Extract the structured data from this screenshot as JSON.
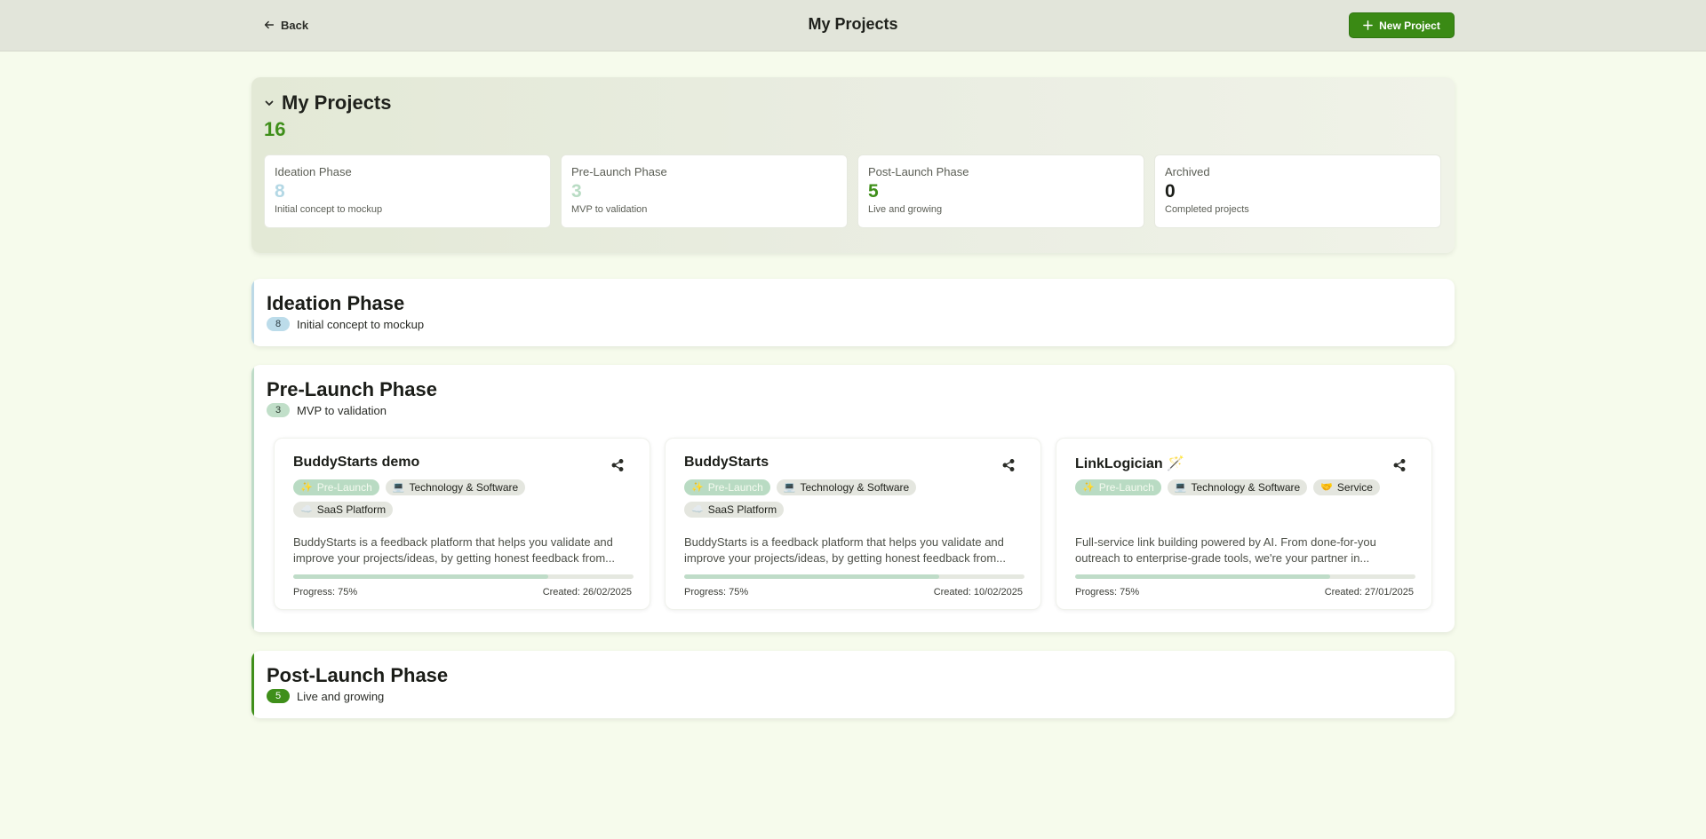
{
  "header": {
    "back_label": "Back",
    "title": "My Projects",
    "new_project_label": "New Project"
  },
  "summary": {
    "title": "My Projects",
    "total": "16",
    "stats": [
      {
        "label": "Ideation Phase",
        "count": "8",
        "desc": "Initial concept to mockup",
        "color": "#b4d8e5"
      },
      {
        "label": "Pre-Launch Phase",
        "count": "3",
        "desc": "MVP to validation",
        "color": "#b9dcc4"
      },
      {
        "label": "Post-Launch Phase",
        "count": "5",
        "desc": "Live and growing",
        "color": "#3f8f1a"
      },
      {
        "label": "Archived",
        "count": "0",
        "desc": "Completed projects",
        "color": "#1b1d18"
      }
    ]
  },
  "phases": {
    "ideation": {
      "title": "Ideation Phase",
      "count": "8",
      "desc": "Initial concept to mockup",
      "pill_bg": "#bcdcea",
      "pill_fg": "#2a3a40"
    },
    "prelaunch": {
      "title": "Pre-Launch Phase",
      "count": "3",
      "desc": "MVP to validation",
      "pill_bg": "#c1dfc9",
      "pill_fg": "#2a3a2f"
    },
    "postlaunch": {
      "title": "Post-Launch Phase",
      "count": "5",
      "desc": "Live and growing",
      "pill_bg": "#3f8f1a",
      "pill_fg": "#ffffff"
    }
  },
  "projects": [
    {
      "title": "BuddyStarts demo",
      "tags": [
        {
          "emoji": "✨",
          "label": "Pre-Launch",
          "kind": "phase"
        },
        {
          "emoji": "💻",
          "label": "Technology & Software",
          "kind": "category"
        },
        {
          "emoji": "☁️",
          "label": "SaaS Platform",
          "kind": "type"
        }
      ],
      "description": "BuddyStarts is a feedback platform that helps you validate and improve your projects/ideas, by getting honest feedback from...",
      "progress_label": "Progress: 75%",
      "progress_value": 0.75,
      "created_label": "Created: 26/02/2025"
    },
    {
      "title": "BuddyStarts",
      "tags": [
        {
          "emoji": "✨",
          "label": "Pre-Launch",
          "kind": "phase"
        },
        {
          "emoji": "💻",
          "label": "Technology & Software",
          "kind": "category"
        },
        {
          "emoji": "☁️",
          "label": "SaaS Platform",
          "kind": "type"
        }
      ],
      "description": "BuddyStarts is a feedback platform that helps you validate and improve your projects/ideas, by getting honest feedback from...",
      "progress_label": "Progress: 75%",
      "progress_value": 0.75,
      "created_label": "Created: 10/02/2025"
    },
    {
      "title": "LinkLogician 🪄",
      "tags": [
        {
          "emoji": "✨",
          "label": "Pre-Launch",
          "kind": "phase"
        },
        {
          "emoji": "💻",
          "label": "Technology & Software",
          "kind": "category"
        },
        {
          "emoji": "🤝",
          "label": "Service",
          "kind": "type"
        }
      ],
      "description": "Full-service link building powered by AI. From done-for-you outreach to enterprise-grade tools, we're your partner in...",
      "progress_label": "Progress: 75%",
      "progress_value": 0.75,
      "created_label": "Created: 27/01/2025"
    }
  ]
}
